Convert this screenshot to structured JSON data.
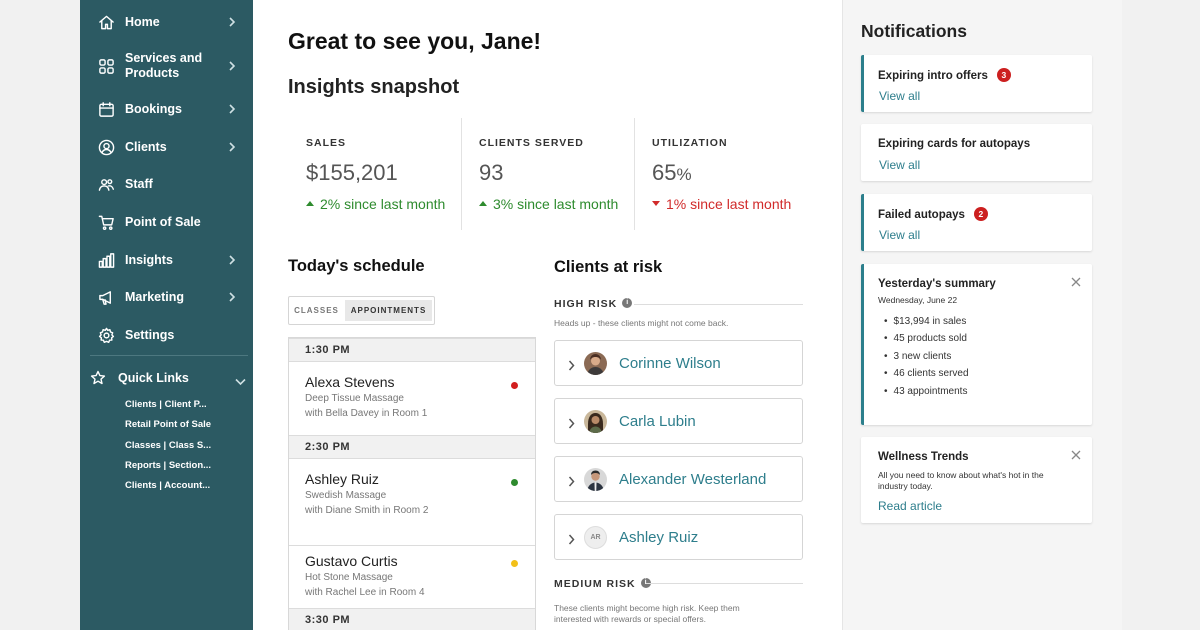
{
  "sidebar": {
    "items": [
      {
        "label": "Home",
        "icon": "home-icon",
        "has_chevron": true
      },
      {
        "label": "Services and Products",
        "icon": "grid-icon",
        "has_chevron": true
      },
      {
        "label": "Bookings",
        "icon": "calendar-icon",
        "has_chevron": true
      },
      {
        "label": "Clients",
        "icon": "user-circle-icon",
        "has_chevron": true
      },
      {
        "label": "Staff",
        "icon": "staff-icon",
        "has_chevron": false
      },
      {
        "label": "Point of Sale",
        "icon": "cart-icon",
        "has_chevron": false
      },
      {
        "label": "Insights",
        "icon": "bar-chart-icon",
        "has_chevron": true
      },
      {
        "label": "Marketing",
        "icon": "megaphone-icon",
        "has_chevron": true
      },
      {
        "label": "Settings",
        "icon": "gear-icon",
        "has_chevron": false
      }
    ],
    "quick_links": {
      "label": "Quick Links",
      "links": [
        "Clients | Client P...",
        "Retail Point of Sale",
        "Classes | Class S...",
        "Reports | Section...",
        "Clients | Account..."
      ]
    },
    "bg_color": "#2c5a63"
  },
  "main": {
    "greeting": "Great to see you, Jane!",
    "insights_title": "Insights snapshot",
    "stats": [
      {
        "label": "SALES",
        "value": "$155,201",
        "unit": "",
        "change": "2% since last month",
        "direction": "up"
      },
      {
        "label": "CLIENTS SERVED",
        "value": "93",
        "unit": "",
        "change": "3% since last month",
        "direction": "up"
      },
      {
        "label": "UTILIZATION",
        "value": "65",
        "unit": "%",
        "change": "1% since last month",
        "direction": "down"
      }
    ],
    "schedule": {
      "title": "Today's schedule",
      "tabs": [
        "CLASSES",
        "APPOINTMENTS"
      ],
      "active_tab": "APPOINTMENTS",
      "times": [
        "1:30 PM",
        "2:30 PM",
        "3:30 PM"
      ],
      "appointments": [
        {
          "name": "Alexa Stevens",
          "service": "Deep Tissue Massage",
          "room": "with Bella Davey in Room 1",
          "status_color": "#d21f1f"
        },
        {
          "name": "Ashley Ruiz",
          "service": "Swedish Massage",
          "room": "with Diane Smith in Room 2",
          "status_color": "#2e8b2e"
        },
        {
          "name": "Gustavo Curtis",
          "service": "Hot Stone Massage",
          "room": "with Rachel Lee in Room 4",
          "status_color": "#f2c019"
        }
      ]
    },
    "at_risk": {
      "title": "Clients at risk",
      "high_label": "HIGH RISK",
      "high_sub": "Heads up - these clients might not come back.",
      "clients": [
        {
          "name": "Corinne Wilson",
          "initials": ""
        },
        {
          "name": "Carla Lubin",
          "initials": ""
        },
        {
          "name": "Alexander Westerland",
          "initials": ""
        },
        {
          "name": "Ashley Ruiz",
          "initials": "AR"
        }
      ],
      "medium_label": "MEDIUM RISK",
      "medium_sub": "These clients might become high risk. Keep them interested with rewards or special offers."
    }
  },
  "notifications": {
    "title": "Notifications",
    "cards": [
      {
        "title": "Expiring intro offers",
        "badge": "3",
        "link": "View all"
      },
      {
        "title": "Expiring cards for autopays",
        "badge": "",
        "link": "View all"
      },
      {
        "title": "Failed autopays",
        "badge": "2",
        "link": "View all"
      }
    ],
    "summary": {
      "title": "Yesterday's summary",
      "date": "Wednesday, June 22",
      "bullets": [
        "$13,994 in sales",
        "45 products sold",
        "3 new clients",
        "46 clients served",
        "43 appointments"
      ]
    },
    "wellness": {
      "title": "Wellness Trends",
      "body": "All you need to know about what's hot in the industry today.",
      "link": "Read article"
    },
    "accent_color": "#2c7f8c",
    "badge_color": "#cc1f1f"
  }
}
